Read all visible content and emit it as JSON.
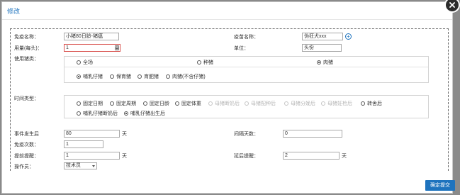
{
  "dialog": {
    "title": "修改",
    "confirm_label": "确定提交"
  },
  "form": {
    "vaccine_name": {
      "label": "免疫名称：",
      "value": "小猪80日龄-猪瘟"
    },
    "vaccine_seedling": {
      "label": "疫苗名称：",
      "value": "伪狂犬xxx"
    },
    "dosage": {
      "label": "用量(每头)：",
      "value": "1"
    },
    "unit": {
      "label": "单位：",
      "value": "头份"
    },
    "pig_type": {
      "label": "使用猪类：",
      "top_options": [
        {
          "label": "全场",
          "selected": false
        },
        {
          "label": "种猪",
          "selected": false
        },
        {
          "label": "肉猪",
          "selected": true
        }
      ],
      "sub_options": [
        {
          "label": "哺乳仔猪",
          "selected": true
        },
        {
          "label": "保育猪",
          "selected": false
        },
        {
          "label": "育肥猪",
          "selected": false
        },
        {
          "label": "肉猪(不含仔猪)",
          "selected": false
        }
      ]
    },
    "time_type": {
      "label": "时间类型：",
      "options_row1": [
        {
          "label": "固定日期",
          "selected": false,
          "disabled": false
        },
        {
          "label": "固定周期",
          "selected": false,
          "disabled": false
        },
        {
          "label": "固定日龄",
          "selected": false,
          "disabled": false
        },
        {
          "label": "固定体重",
          "selected": false,
          "disabled": false
        },
        {
          "label": "母猪断奶后",
          "selected": false,
          "disabled": true
        },
        {
          "label": "母猪配种后",
          "selected": false,
          "disabled": true
        },
        {
          "label": "母猪分娩后",
          "selected": false,
          "disabled": true
        },
        {
          "label": "母猪妊检后",
          "selected": false,
          "disabled": true
        },
        {
          "label": "转舍后",
          "selected": false,
          "disabled": false
        }
      ],
      "options_row2": [
        {
          "label": "哺乳仔猪断奶后",
          "selected": false,
          "disabled": false
        },
        {
          "label": "哺乳仔猪出生后",
          "selected": true,
          "disabled": false
        }
      ]
    },
    "event_after": {
      "label": "事件发生后",
      "value": "80",
      "unit": "天"
    },
    "interval_days": {
      "label": "间隔天数：",
      "value": "0"
    },
    "times": {
      "label": "免疫次数：",
      "value": "1"
    },
    "pre_remind": {
      "label": "提前提醒：",
      "value": "1",
      "unit": "天"
    },
    "post_remind": {
      "label": "延后提醒：",
      "value": "2",
      "unit": "天"
    },
    "operator": {
      "label": "操作员：",
      "value": "技术员"
    }
  }
}
